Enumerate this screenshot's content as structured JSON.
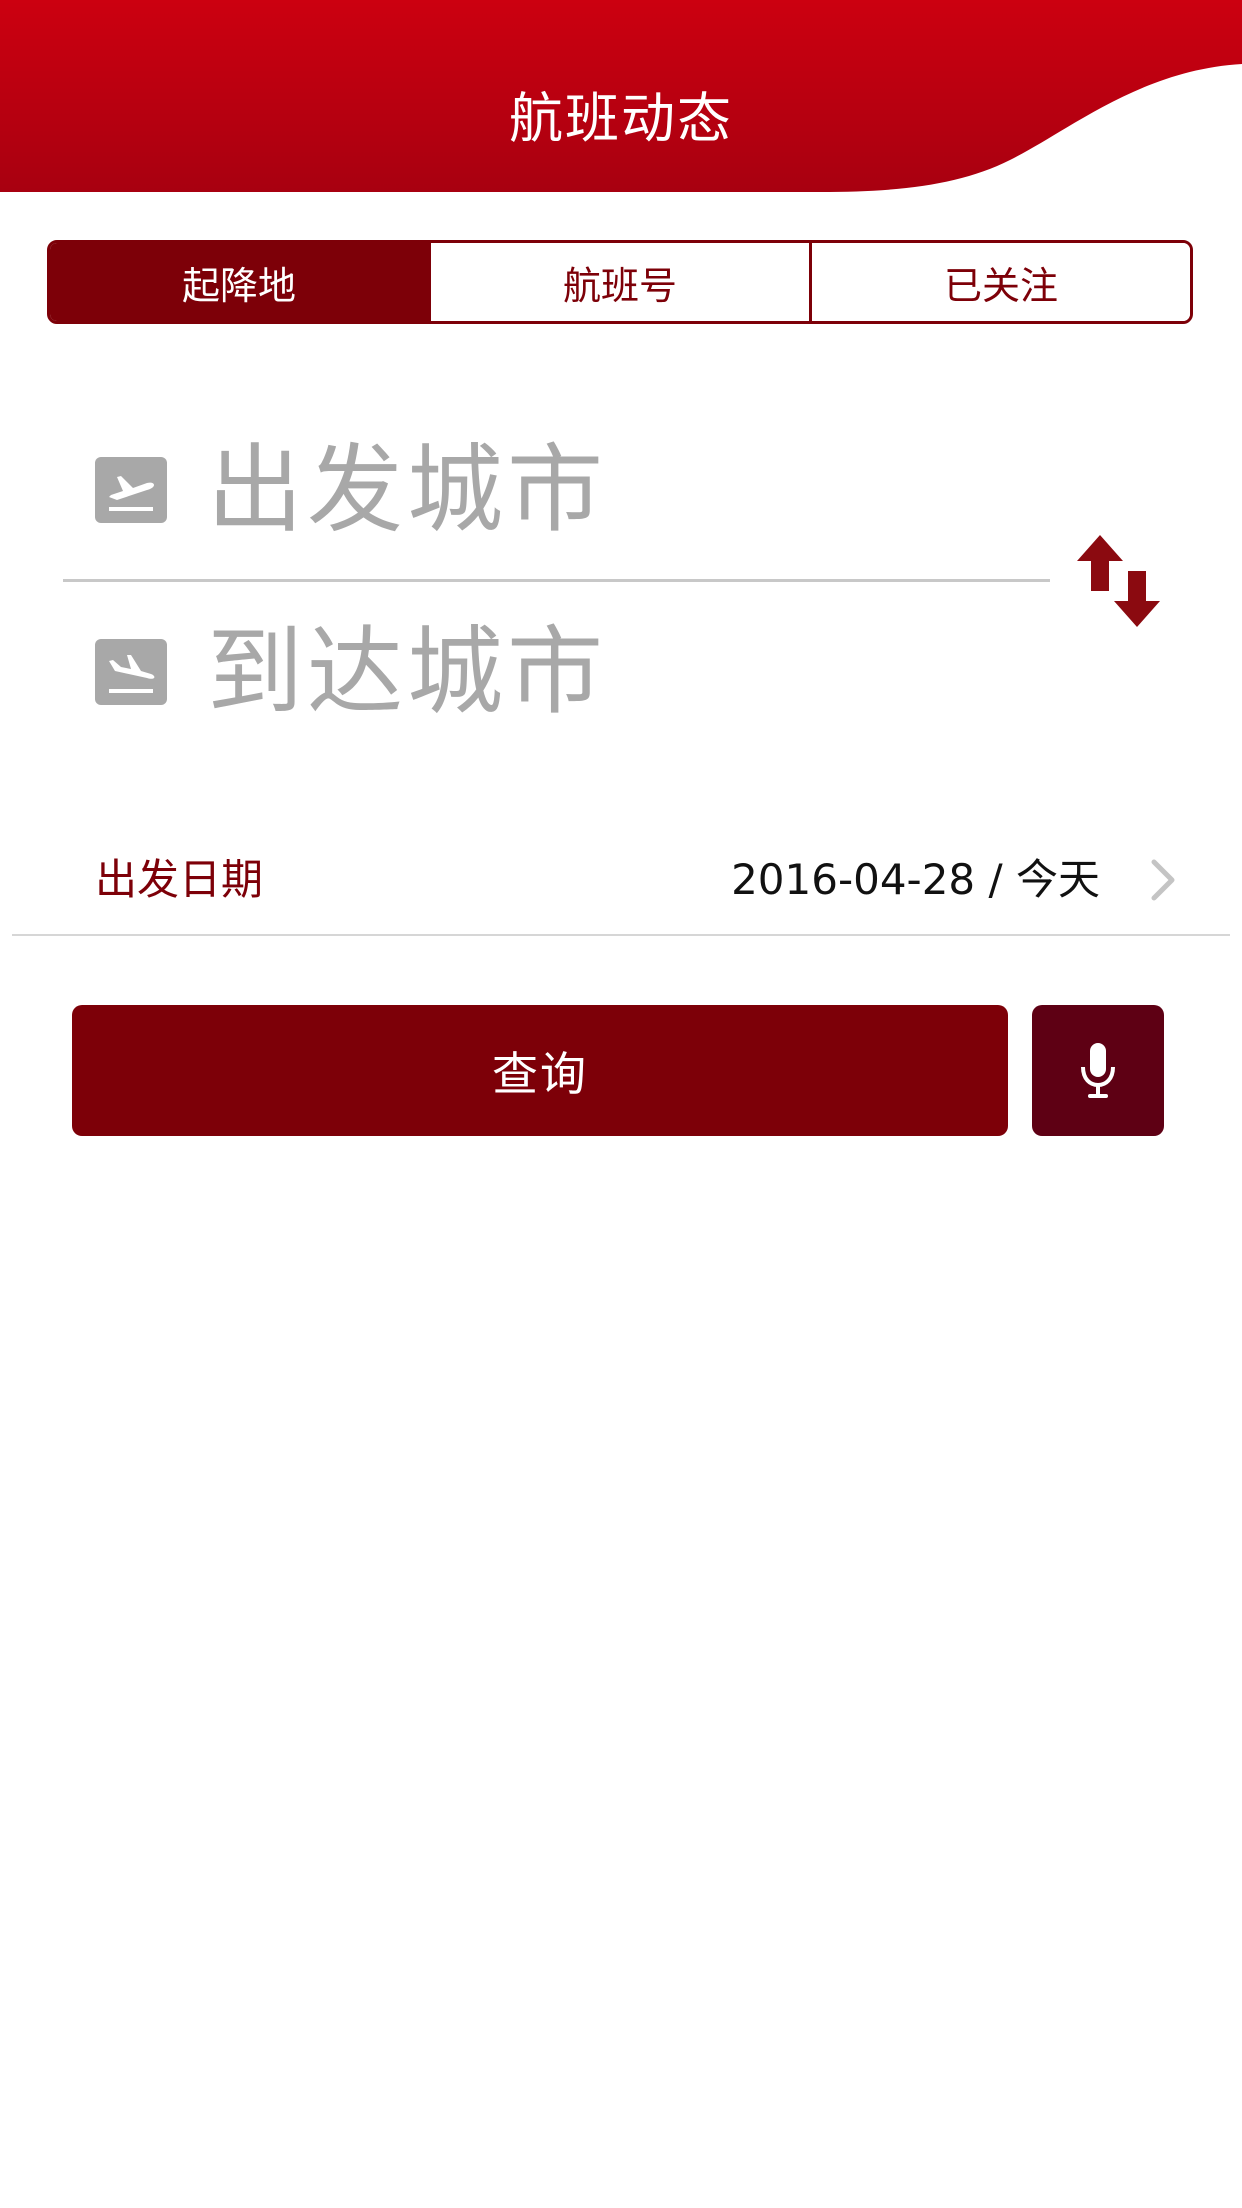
{
  "header": {
    "title": "航班动态"
  },
  "tabs": [
    {
      "label": "起降地",
      "active": true
    },
    {
      "label": "航班号",
      "active": false
    },
    {
      "label": "已关注",
      "active": false
    }
  ],
  "search": {
    "departure_placeholder": "出发城市",
    "arrival_placeholder": "到达城市",
    "departure_icon": "takeoff-icon",
    "arrival_icon": "landing-icon",
    "swap_icon": "swap-arrows-icon"
  },
  "date": {
    "label": "出发日期",
    "value": "2016-04-28 / 今天"
  },
  "actions": {
    "query_label": "查询",
    "voice_icon": "microphone-icon"
  },
  "colors": {
    "brand_red": "#c8000f",
    "dark_red": "#7d0008",
    "mic_bg": "#5e0014",
    "placeholder_gray": "#a8a8a8"
  }
}
